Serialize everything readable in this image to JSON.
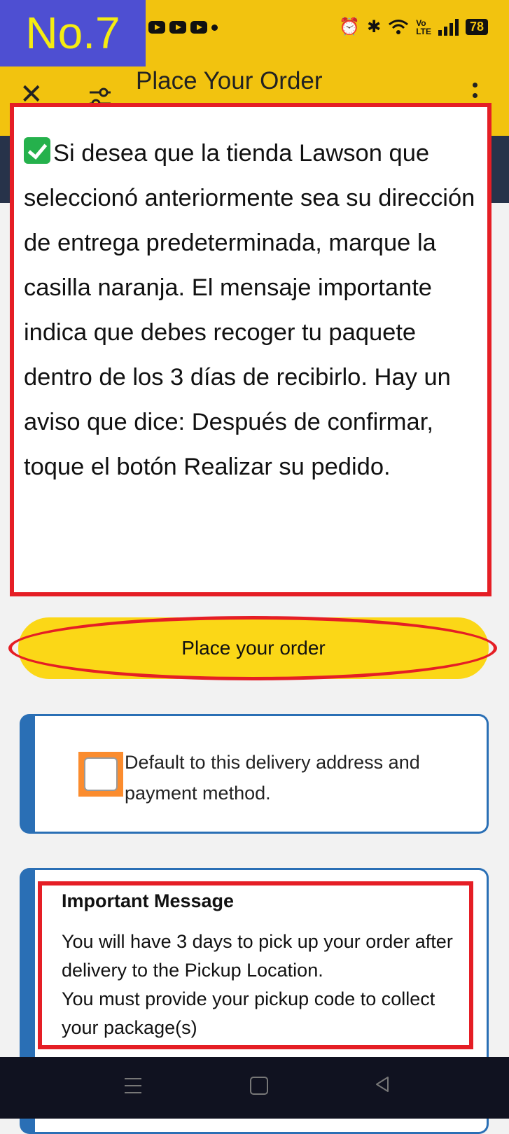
{
  "badge": {
    "label": "No.7"
  },
  "status_bar": {
    "battery": "78",
    "volte_top": "Vo",
    "volte_bottom": "LTE"
  },
  "app_bar": {
    "title": "Place Your Order"
  },
  "instruction": {
    "text": "Si desea que la tienda Lawson que seleccionó anteriormente sea su dirección de entrega predeterminada, marque la casilla naranja. El mensaje importante indica que debes recoger tu paquete dentro de los 3 días de recibirlo. Hay un aviso que dice: Después de confirmar, toque el botón Realizar su pedido."
  },
  "order_button": {
    "label": "Place your order"
  },
  "default_option": {
    "label": "Default to this delivery address and payment method.",
    "checked": false
  },
  "important_message": {
    "title": "Important Message",
    "line1": "You will have 3 days to pick up your order after delivery to the Pickup Location.",
    "line2": "You must provide your pickup code to collect your package(s)"
  },
  "colors": {
    "app_bar": "#f2c30f",
    "badge_bg": "#4e4fd2",
    "badge_text": "#f5ec11",
    "button": "#fbd717",
    "highlight": "#e51e25",
    "card_border": "#2a6fb5",
    "checkbox_highlight": "#fb8c2e"
  },
  "icons": {
    "close": "close-icon",
    "filter": "filter-icon",
    "more": "more-vertical-icon",
    "check": "check-box-icon",
    "nav": [
      "menu-icon",
      "home-icon",
      "back-icon"
    ]
  }
}
